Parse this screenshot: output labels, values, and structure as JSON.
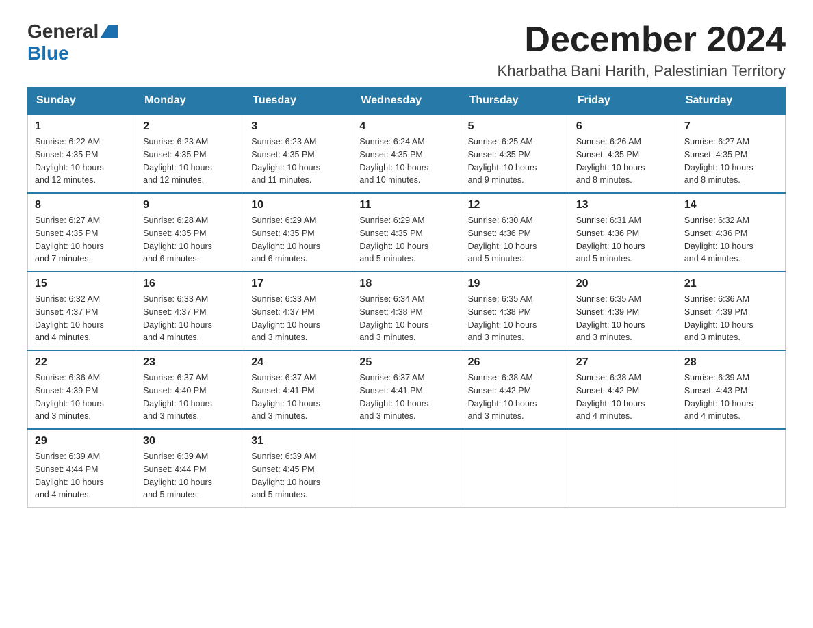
{
  "header": {
    "logo_general": "General",
    "logo_blue": "Blue",
    "month_title": "December 2024",
    "location": "Kharbatha Bani Harith, Palestinian Territory"
  },
  "weekdays": [
    "Sunday",
    "Monday",
    "Tuesday",
    "Wednesday",
    "Thursday",
    "Friday",
    "Saturday"
  ],
  "weeks": [
    [
      {
        "day": "1",
        "sunrise": "6:22 AM",
        "sunset": "4:35 PM",
        "daylight": "10 hours and 12 minutes."
      },
      {
        "day": "2",
        "sunrise": "6:23 AM",
        "sunset": "4:35 PM",
        "daylight": "10 hours and 12 minutes."
      },
      {
        "day": "3",
        "sunrise": "6:23 AM",
        "sunset": "4:35 PM",
        "daylight": "10 hours and 11 minutes."
      },
      {
        "day": "4",
        "sunrise": "6:24 AM",
        "sunset": "4:35 PM",
        "daylight": "10 hours and 10 minutes."
      },
      {
        "day": "5",
        "sunrise": "6:25 AM",
        "sunset": "4:35 PM",
        "daylight": "10 hours and 9 minutes."
      },
      {
        "day": "6",
        "sunrise": "6:26 AM",
        "sunset": "4:35 PM",
        "daylight": "10 hours and 8 minutes."
      },
      {
        "day": "7",
        "sunrise": "6:27 AM",
        "sunset": "4:35 PM",
        "daylight": "10 hours and 8 minutes."
      }
    ],
    [
      {
        "day": "8",
        "sunrise": "6:27 AM",
        "sunset": "4:35 PM",
        "daylight": "10 hours and 7 minutes."
      },
      {
        "day": "9",
        "sunrise": "6:28 AM",
        "sunset": "4:35 PM",
        "daylight": "10 hours and 6 minutes."
      },
      {
        "day": "10",
        "sunrise": "6:29 AM",
        "sunset": "4:35 PM",
        "daylight": "10 hours and 6 minutes."
      },
      {
        "day": "11",
        "sunrise": "6:29 AM",
        "sunset": "4:35 PM",
        "daylight": "10 hours and 5 minutes."
      },
      {
        "day": "12",
        "sunrise": "6:30 AM",
        "sunset": "4:36 PM",
        "daylight": "10 hours and 5 minutes."
      },
      {
        "day": "13",
        "sunrise": "6:31 AM",
        "sunset": "4:36 PM",
        "daylight": "10 hours and 5 minutes."
      },
      {
        "day": "14",
        "sunrise": "6:32 AM",
        "sunset": "4:36 PM",
        "daylight": "10 hours and 4 minutes."
      }
    ],
    [
      {
        "day": "15",
        "sunrise": "6:32 AM",
        "sunset": "4:37 PM",
        "daylight": "10 hours and 4 minutes."
      },
      {
        "day": "16",
        "sunrise": "6:33 AM",
        "sunset": "4:37 PM",
        "daylight": "10 hours and 4 minutes."
      },
      {
        "day": "17",
        "sunrise": "6:33 AM",
        "sunset": "4:37 PM",
        "daylight": "10 hours and 3 minutes."
      },
      {
        "day": "18",
        "sunrise": "6:34 AM",
        "sunset": "4:38 PM",
        "daylight": "10 hours and 3 minutes."
      },
      {
        "day": "19",
        "sunrise": "6:35 AM",
        "sunset": "4:38 PM",
        "daylight": "10 hours and 3 minutes."
      },
      {
        "day": "20",
        "sunrise": "6:35 AM",
        "sunset": "4:39 PM",
        "daylight": "10 hours and 3 minutes."
      },
      {
        "day": "21",
        "sunrise": "6:36 AM",
        "sunset": "4:39 PM",
        "daylight": "10 hours and 3 minutes."
      }
    ],
    [
      {
        "day": "22",
        "sunrise": "6:36 AM",
        "sunset": "4:39 PM",
        "daylight": "10 hours and 3 minutes."
      },
      {
        "day": "23",
        "sunrise": "6:37 AM",
        "sunset": "4:40 PM",
        "daylight": "10 hours and 3 minutes."
      },
      {
        "day": "24",
        "sunrise": "6:37 AM",
        "sunset": "4:41 PM",
        "daylight": "10 hours and 3 minutes."
      },
      {
        "day": "25",
        "sunrise": "6:37 AM",
        "sunset": "4:41 PM",
        "daylight": "10 hours and 3 minutes."
      },
      {
        "day": "26",
        "sunrise": "6:38 AM",
        "sunset": "4:42 PM",
        "daylight": "10 hours and 3 minutes."
      },
      {
        "day": "27",
        "sunrise": "6:38 AM",
        "sunset": "4:42 PM",
        "daylight": "10 hours and 4 minutes."
      },
      {
        "day": "28",
        "sunrise": "6:39 AM",
        "sunset": "4:43 PM",
        "daylight": "10 hours and 4 minutes."
      }
    ],
    [
      {
        "day": "29",
        "sunrise": "6:39 AM",
        "sunset": "4:44 PM",
        "daylight": "10 hours and 4 minutes."
      },
      {
        "day": "30",
        "sunrise": "6:39 AM",
        "sunset": "4:44 PM",
        "daylight": "10 hours and 5 minutes."
      },
      {
        "day": "31",
        "sunrise": "6:39 AM",
        "sunset": "4:45 PM",
        "daylight": "10 hours and 5 minutes."
      },
      null,
      null,
      null,
      null
    ]
  ],
  "labels": {
    "sunrise": "Sunrise:",
    "sunset": "Sunset:",
    "daylight": "Daylight:"
  }
}
